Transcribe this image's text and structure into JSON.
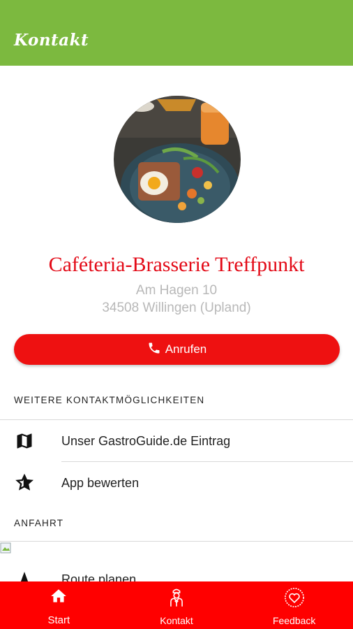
{
  "header": {
    "title": "Kontakt"
  },
  "business": {
    "name": "Caféteria-Brasserie Treffpunkt",
    "address_line1": "Am Hagen 10",
    "address_line2": "34508 Willingen (Upland)"
  },
  "call_button": {
    "label": "Anrufen"
  },
  "sections": {
    "more_contact": "WEITERE KONTAKTMÖGLICHKEITEN",
    "directions": "ANFAHRT"
  },
  "contact_items": [
    {
      "label": "Unser GastroGuide.de Eintrag",
      "icon": "map-icon"
    },
    {
      "label": "App bewerten",
      "icon": "star-icon"
    }
  ],
  "directions_items": [
    {
      "label": "Route planen",
      "icon": "navigation-icon"
    }
  ],
  "bottom_nav": [
    {
      "label": "Start",
      "icon": "home-icon",
      "active": true
    },
    {
      "label": "Kontakt",
      "icon": "waiter-icon",
      "active": false
    },
    {
      "label": "Feedback",
      "icon": "heart-icon",
      "active": false
    }
  ],
  "colors": {
    "topbar": "#7cb93f",
    "accent": "#ee1111",
    "bottom_nav": "#ff0000"
  }
}
